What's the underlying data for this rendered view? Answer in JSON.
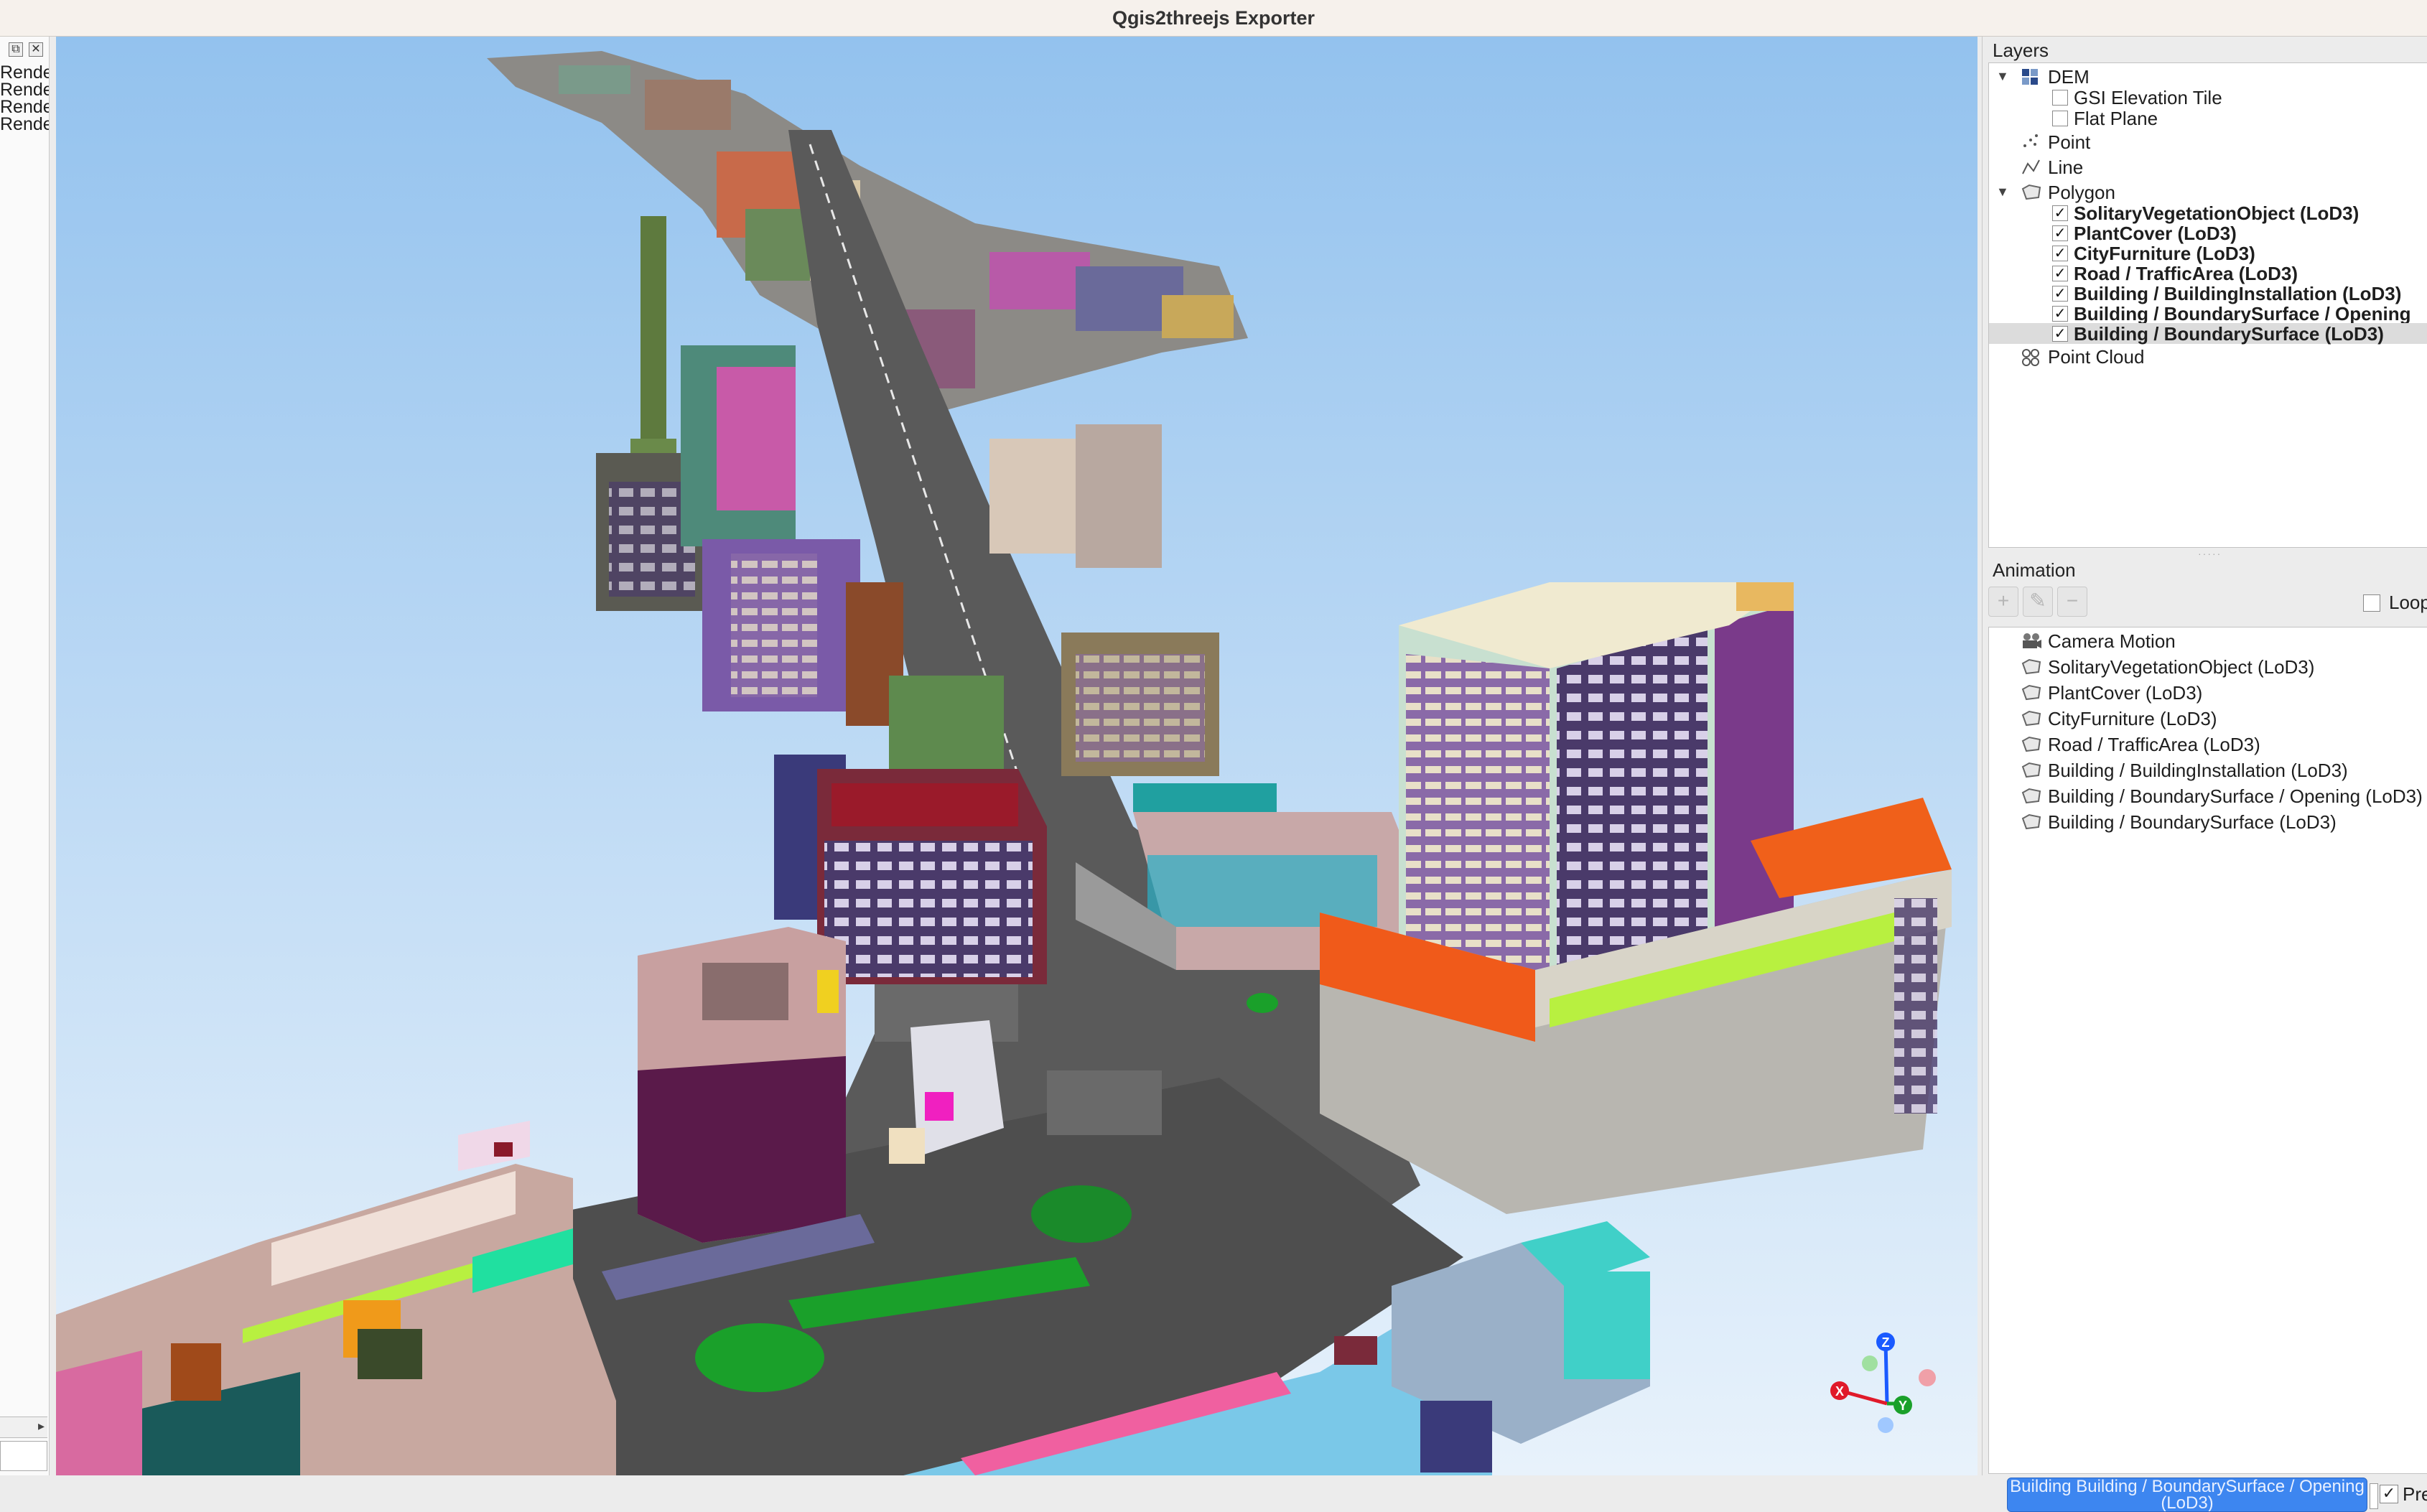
{
  "window": {
    "title": "Qgis2threejs Exporter"
  },
  "left_log": {
    "lines": [
      "Rende",
      "Rende",
      "Rende",
      "Rende"
    ],
    "float_icon": "float-icon",
    "close_icon": "close-icon"
  },
  "layers_panel": {
    "title": "Layers",
    "items": [
      {
        "label": "DEM",
        "icon": "dem-raster-icon",
        "expanded": true
      },
      {
        "label": "GSI Elevation Tile",
        "checked": false
      },
      {
        "label": "Flat Plane",
        "checked": false
      },
      {
        "label": "Point",
        "icon": "point-layer-icon"
      },
      {
        "label": "Line",
        "icon": "line-layer-icon"
      },
      {
        "label": "Polygon",
        "icon": "polygon-layer-icon",
        "expanded": true
      },
      {
        "label": "SolitaryVegetationObject (LoD3)",
        "checked": true
      },
      {
        "label": "PlantCover (LoD3)",
        "checked": true
      },
      {
        "label": "CityFurniture (LoD3)",
        "checked": true
      },
      {
        "label": "Road / TrafficArea (LoD3)",
        "checked": true
      },
      {
        "label": "Building / BuildingInstallation (LoD3)",
        "checked": true
      },
      {
        "label": "Building / BoundarySurface / Opening",
        "checked": true
      },
      {
        "label": "Building / BoundarySurface (LoD3)",
        "checked": true,
        "selected": true
      },
      {
        "label": "Point Cloud",
        "icon": "point-cloud-icon"
      }
    ]
  },
  "animation_panel": {
    "title": "Animation",
    "buttons": [
      "add-keyframe-icon",
      "edit-keyframe-icon",
      "remove-keyframe-icon"
    ],
    "loop_label": "Loop",
    "loop_checked": false,
    "items": [
      {
        "label": "Camera Motion",
        "icon": "camera-icon"
      },
      {
        "label": "SolitaryVegetationObject (LoD3)",
        "icon": "polygon-layer-icon"
      },
      {
        "label": "PlantCover (LoD3)",
        "icon": "polygon-layer-icon"
      },
      {
        "label": "CityFurniture (LoD3)",
        "icon": "polygon-layer-icon"
      },
      {
        "label": "Road / TrafficArea (LoD3)",
        "icon": "polygon-layer-icon"
      },
      {
        "label": "Building / BuildingInstallation (LoD3)",
        "icon": "polygon-layer-icon"
      },
      {
        "label": "Building / BoundarySurface / Opening (LoD3)",
        "icon": "polygon-layer-icon"
      },
      {
        "label": "Building / BoundarySurface (LoD3)",
        "icon": "polygon-layer-icon"
      }
    ]
  },
  "bottom_bar": {
    "progress_button_label": "Building Building / BoundarySurface / Opening (LoD3)",
    "preview_label": "Pre",
    "preview_checked": true
  },
  "viewport": {
    "sky_top": "#93c2ee",
    "sky_bottom": "#e6f1fb",
    "road_color": "#5a5a5a",
    "axis_gizmo": {
      "x_label": "X",
      "y_label": "Y",
      "z_label": "Z"
    }
  }
}
